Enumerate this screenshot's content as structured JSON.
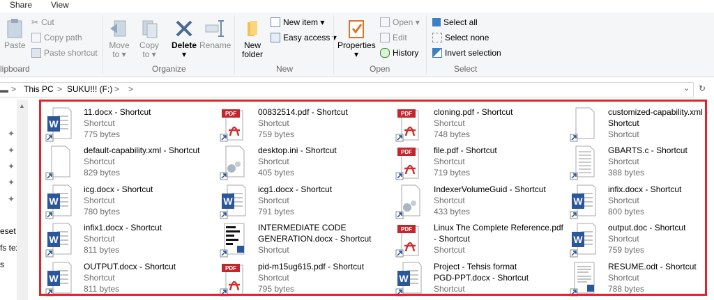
{
  "menubar": {
    "share": "Share",
    "view": "View"
  },
  "ribbon": {
    "clipboard": {
      "paste": "Paste",
      "cut": "Cut",
      "copy_path": "Copy path",
      "paste_shortcut": "Paste shortcut",
      "group": "lipboard"
    },
    "organize": {
      "move_to_1": "Move",
      "move_to_2": "to ▾",
      "copy_to_1": "Copy",
      "copy_to_2": "to ▾",
      "delete_1": "Delete",
      "delete_2": "▾",
      "rename": "Rename",
      "group": "Organize"
    },
    "new": {
      "new_folder_1": "New",
      "new_folder_2": "folder",
      "new_item": "New item ▾",
      "easy_access": "Easy access ▾",
      "group": "New"
    },
    "open": {
      "properties_1": "Properties",
      "properties_2": "▾",
      "open": "Open ▾",
      "edit": "Edit",
      "history": "History",
      "group": "Open"
    },
    "select": {
      "select_all": "Select all",
      "select_none": "Select none",
      "invert": "Invert selection",
      "group": "Select"
    }
  },
  "address": {
    "this_pc": "This PC",
    "drive": "SUKU!!! (F:)",
    "sep": ">"
  },
  "nav": {
    "item1": "eset",
    "item2": "fs tex",
    "item3": "s"
  },
  "files": [
    {
      "name": "11.docx - Shortcut",
      "type": "Shortcut",
      "size": "775 bytes",
      "icon": "word"
    },
    {
      "name": "00832514.pdf - Shortcut",
      "type": "Shortcut",
      "size": "759 bytes",
      "icon": "pdf"
    },
    {
      "name": "cloning.pdf - Shortcut",
      "type": "Shortcut",
      "size": "748 bytes",
      "icon": "pdf"
    },
    {
      "name": "customized-capability.xml -",
      "name2": "Shortcut",
      "type": "Shortcut",
      "size": "",
      "icon": "blank"
    },
    {
      "name": "default-capability.xml - Shortcut",
      "type": "Shortcut",
      "size": "829 bytes",
      "icon": "blank"
    },
    {
      "name": "desktop.ini - Shortcut",
      "type": "Shortcut",
      "size": "405 bytes",
      "icon": "gear"
    },
    {
      "name": "file.pdf - Shortcut",
      "type": "Shortcut",
      "size": "719 bytes",
      "icon": "pdf"
    },
    {
      "name": "GBARTS.c - Shortcut",
      "type": "Shortcut",
      "size": "388 bytes",
      "icon": "text"
    },
    {
      "name": "icg.docx - Shortcut",
      "type": "Shortcut",
      "size": "780 bytes",
      "icon": "word"
    },
    {
      "name": "icg1.docx - Shortcut",
      "type": "Shortcut",
      "size": "791 bytes",
      "icon": "word"
    },
    {
      "name": "IndexerVolumeGuid - Shortcut",
      "type": "Shortcut",
      "size": "433 bytes",
      "icon": "gear"
    },
    {
      "name": "infix.docx - Shortcut",
      "type": "Shortcut",
      "size": "800 bytes",
      "icon": "word"
    },
    {
      "name": "infix1.docx - Shortcut",
      "type": "Shortcut",
      "size": "811 bytes",
      "icon": "word"
    },
    {
      "name": "INTERMEDIATE CODE",
      "name2": "GENERATION.docx - Shortcut",
      "type": "Shortcut",
      "size": "",
      "icon": "thumb"
    },
    {
      "name": "Linux The Complete Reference.pdf",
      "name2": "- Shortcut",
      "type": "Shortcut",
      "size": "",
      "icon": "pdf"
    },
    {
      "name": "output.doc - Shortcut",
      "type": "Shortcut",
      "size": "759 bytes",
      "icon": "word"
    },
    {
      "name": "OUTPUT.docx - Shortcut",
      "type": "Shortcut",
      "size": "811 bytes",
      "icon": "word"
    },
    {
      "name": "pid-m15ug615.pdf - Shortcut",
      "type": "Shortcut",
      "size": "795 bytes",
      "icon": "pdf"
    },
    {
      "name": "Project - Tehsis  format",
      "name2": "PGD-PPT.docx - Shortcut",
      "type": "Shortcut",
      "size": "",
      "icon": "word"
    },
    {
      "name": "RESUME.odt - Shortcut",
      "type": "Shortcut",
      "size": "788 bytes",
      "icon": "odt"
    }
  ]
}
